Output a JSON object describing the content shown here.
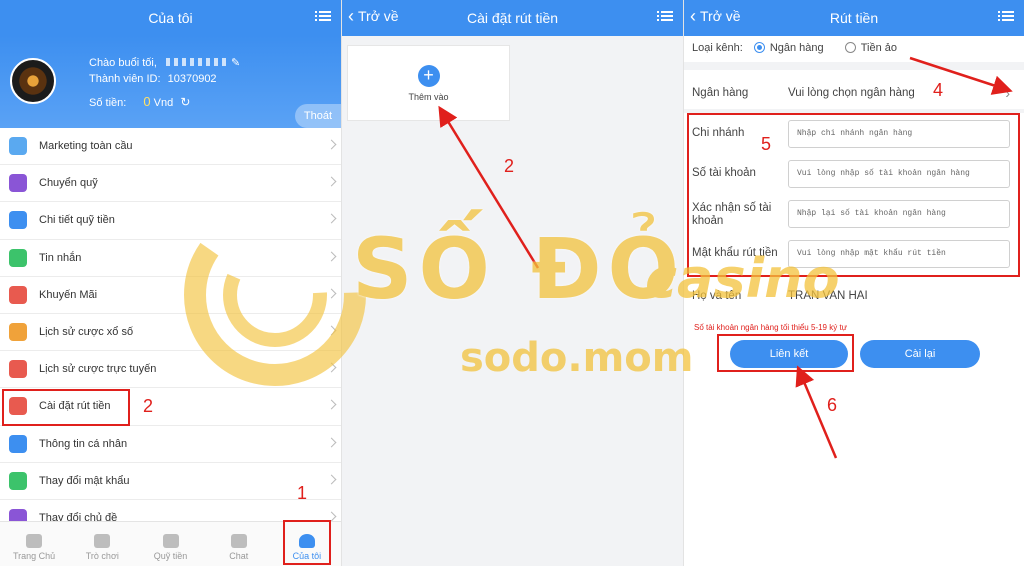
{
  "panel1": {
    "title": "Của tôi",
    "greeting": "Chào buổi tối,",
    "member_id_label": "Thành viên ID:",
    "member_id": "10370902",
    "balance_label": "Số tiền:",
    "balance_value": "0",
    "balance_unit": "Vnd",
    "logout": "Thoát",
    "menu": [
      {
        "label": "Marketing toàn cầu",
        "icon": "diamond-icon",
        "color": "#5aa9f0"
      },
      {
        "label": "Chuyển quỹ",
        "icon": "transfer-icon",
        "color": "#8a55d6"
      },
      {
        "label": "Chi tiết quỹ tiền",
        "icon": "fund-detail-icon",
        "color": "#3d8ff0"
      },
      {
        "label": "Tin nhắn",
        "icon": "message-icon",
        "color": "#3cc36b"
      },
      {
        "label": "Khuyến Mãi",
        "icon": "gift-icon",
        "color": "#e85a4f"
      },
      {
        "label": "Lịch sử cược xổ số",
        "icon": "lottery-history-icon",
        "color": "#f0a23a"
      },
      {
        "label": "Lịch sử cược trực tuyến",
        "icon": "online-history-icon",
        "color": "#e85a4f"
      },
      {
        "label": "Cài đặt rút tiền",
        "icon": "withdraw-settings-icon",
        "color": "#e85a4f"
      },
      {
        "label": "Thông tin cá nhân",
        "icon": "profile-card-icon",
        "color": "#3d8ff0"
      },
      {
        "label": "Thay đổi mật khẩu",
        "icon": "lock-icon",
        "color": "#3cc36b"
      },
      {
        "label": "Thay đổi chủ đề",
        "icon": "theme-icon",
        "color": "#8a55d6"
      }
    ],
    "tabs": [
      {
        "label": "Trang Chủ",
        "icon": "home-icon"
      },
      {
        "label": "Trò chơi",
        "icon": "gamepad-icon"
      },
      {
        "label": "Quỹ tiền",
        "icon": "wallet-icon"
      },
      {
        "label": "Chat",
        "icon": "chat-icon"
      },
      {
        "label": "Của tôi",
        "icon": "user-icon"
      }
    ],
    "annot_step1": "1",
    "annot_step2": "2"
  },
  "panel2": {
    "back": "Trở về",
    "title": "Cài đặt rút tiền",
    "add_label": "Thêm vào",
    "annot_step2": "2"
  },
  "panel3": {
    "back": "Trở về",
    "title": "Rút tiền",
    "channel_label": "Loại kênh:",
    "channel_bank": "Ngân hàng",
    "channel_ewallet": "Tiền ảo",
    "bank_label": "Ngân hàng",
    "bank_placeholder": "Vui lòng chọn ngân hàng",
    "fields": [
      {
        "label": "Chi nhánh",
        "placeholder": "Nhập chi nhánh ngân hàng"
      },
      {
        "label": "Số tài khoản",
        "placeholder": "Vui lòng nhập số tài khoản ngân hàng"
      },
      {
        "label": "Xác nhận số tài khoản",
        "placeholder": "Nhập lại số tài khoản ngân hàng"
      },
      {
        "label": "Mật khẩu rút tiền",
        "placeholder": "Vui lòng nhập mật khẩu rút tiền"
      }
    ],
    "name_label": "Họ và tên",
    "name_value": "TRAN VAN HAI",
    "hint": "Số tài khoản ngân hàng tối thiểu 5-19 ký tự",
    "link_button": "Liên kết",
    "reset_button": "Cài lại",
    "annot_step4": "4",
    "annot_step5": "5",
    "annot_step6": "6"
  },
  "watermark": {
    "brand": "SỐ ĐỎ",
    "brand_sub": "casino",
    "site": "sodo.mom"
  },
  "colors": {
    "primary": "#3d8ff0",
    "annotation": "#e0201c",
    "watermark": "#f3c23c"
  }
}
